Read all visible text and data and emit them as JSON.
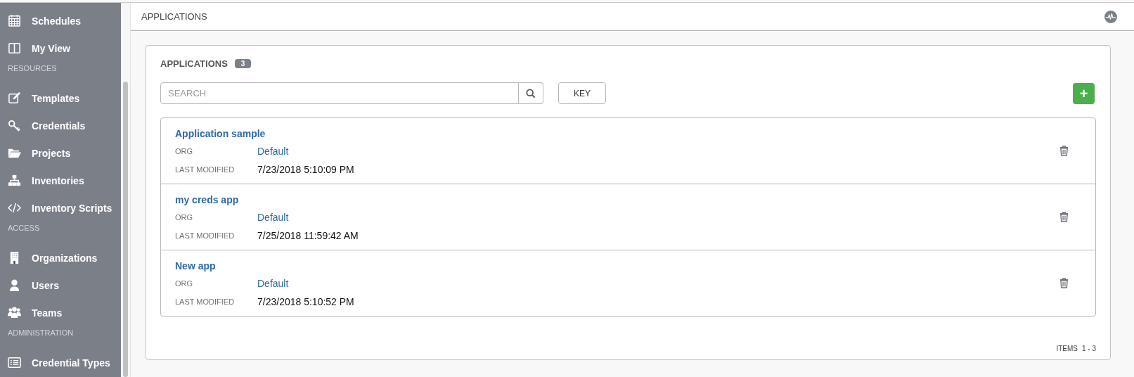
{
  "sidebar": {
    "items": [
      {
        "kind": "link",
        "label": "Schedules"
      },
      {
        "kind": "link",
        "label": "My View"
      },
      {
        "kind": "heading",
        "label": "RESOURCES"
      },
      {
        "kind": "link",
        "label": "Templates"
      },
      {
        "kind": "link",
        "label": "Credentials"
      },
      {
        "kind": "link",
        "label": "Projects"
      },
      {
        "kind": "link",
        "label": "Inventories"
      },
      {
        "kind": "link",
        "label": "Inventory Scripts"
      },
      {
        "kind": "heading",
        "label": "ACCESS"
      },
      {
        "kind": "link",
        "label": "Organizations"
      },
      {
        "kind": "link",
        "label": "Users"
      },
      {
        "kind": "link",
        "label": "Teams"
      },
      {
        "kind": "heading",
        "label": "ADMINISTRATION"
      },
      {
        "kind": "link",
        "label": "Credential Types"
      }
    ]
  },
  "header": {
    "title": "APPLICATIONS"
  },
  "panel": {
    "title": "APPLICATIONS",
    "count": "3",
    "search": {
      "placeholder": "SEARCH"
    },
    "key_button": "KEY",
    "add_button": "+",
    "rows": [
      {
        "name": "Application sample",
        "org_label": "ORG",
        "org": "Default",
        "modified_label": "LAST MODIFIED",
        "modified": "7/23/2018 5:10:09 PM"
      },
      {
        "name": "my creds app",
        "org_label": "ORG",
        "org": "Default",
        "modified_label": "LAST MODIFIED",
        "modified": "7/25/2018 11:59:42 AM"
      },
      {
        "name": "New app",
        "org_label": "ORG",
        "org": "Default",
        "modified_label": "LAST MODIFIED",
        "modified": "7/23/2018 5:10:52 PM"
      }
    ],
    "items_label": "ITEMS",
    "items_range": "1 - 3"
  }
}
